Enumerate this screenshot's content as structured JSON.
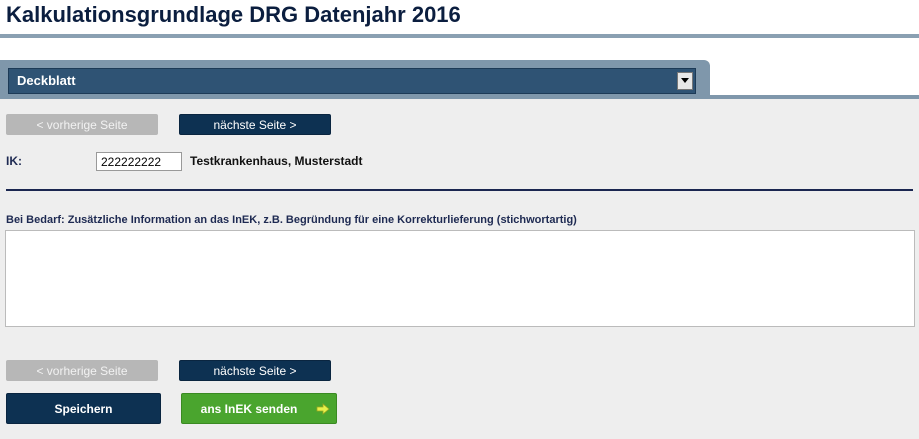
{
  "page": {
    "title": "Kalkulationsgrundlage DRG Datenjahr 2016"
  },
  "tab": {
    "selected": "Deckblatt"
  },
  "nav": {
    "prev_label": "< vorherige Seite",
    "next_label": "nächste Seite >"
  },
  "ik": {
    "label": "IK:",
    "value": "222222222",
    "hospital": "Testkrankenhaus, Musterstadt"
  },
  "info": {
    "label": "Bei Bedarf: Zusätzliche Information an das InEK, z.B. Begründung für eine Korrekturlieferung (stichwortartig)",
    "value": ""
  },
  "actions": {
    "save_label": "Speichern",
    "send_label": "ans InEK senden"
  },
  "colors": {
    "navy": "#0d3152",
    "green": "#4aa52e",
    "disabled": "#b7b7b7"
  },
  "icons": {
    "dropdown": "chevron-down-icon",
    "send": "arrow-right-icon"
  }
}
